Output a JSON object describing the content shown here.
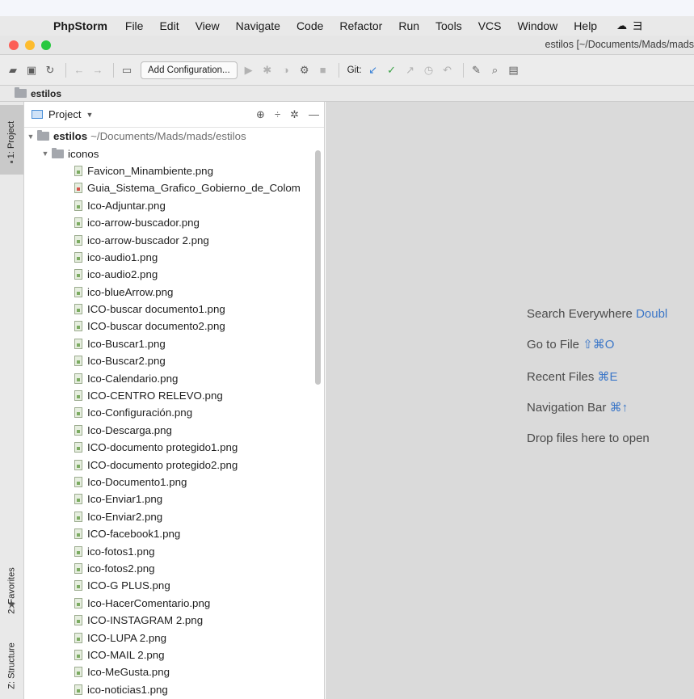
{
  "menubar": {
    "app_name": "PhpStorm",
    "items": [
      "File",
      "Edit",
      "View",
      "Navigate",
      "Code",
      "Refactor",
      "Run",
      "Tools",
      "VCS",
      "Window",
      "Help"
    ],
    "tail_glyph": "ヨ"
  },
  "window": {
    "title": "estilos [~/Documents/Mads/mads"
  },
  "toolbar": {
    "config_label": "Add Configuration...",
    "git_label": "Git:"
  },
  "navbar": {
    "crumb": "estilos"
  },
  "sidestrip": {
    "project_tab": "1: Project",
    "favorites_tab": "2: Favorites",
    "structure_tab": "Z: Structure"
  },
  "project": {
    "header_label": "Project",
    "root_name": "estilos",
    "root_path": "~/Documents/Mads/mads/estilos",
    "folder_name": "iconos",
    "files": [
      "Favicon_Minambiente.png",
      "Guia_Sistema_Grafico_Gobierno_de_Colom",
      "Ico-Adjuntar.png",
      "ico-arrow-buscador.png",
      "ico-arrow-buscador 2.png",
      "ico-audio1.png",
      "ico-audio2.png",
      "ico-blueArrow.png",
      "ICO-buscar documento1.png",
      "ICO-buscar documento2.png",
      "Ico-Buscar1.png",
      "Ico-Buscar2.png",
      "Ico-Calendario.png",
      "ICO-CENTRO RELEVO.png",
      "Ico-Configuración.png",
      "Ico-Descarga.png",
      "ICO-documento protegido1.png",
      "ICO-documento protegido2.png",
      "Ico-Documento1.png",
      "Ico-Enviar1.png",
      "Ico-Enviar2.png",
      "ICO-facebook1.png",
      "ico-fotos1.png",
      "ico-fotos2.png",
      "ICO-G PLUS.png",
      "Ico-HacerComentario.png",
      "ICO-INSTAGRAM 2.png",
      "ICO-LUPA 2.png",
      "ICO-MAIL 2.png",
      "Ico-MeGusta.png",
      "ico-noticias1.png"
    ]
  },
  "editor": {
    "hints": [
      {
        "text": "Search Everywhere ",
        "key": "Doubl"
      },
      {
        "text": "Go to File ",
        "key": "⇧⌘O"
      },
      {
        "text": "Recent Files ",
        "key": "⌘E"
      },
      {
        "text": "Navigation Bar ",
        "key": "⌘↑"
      },
      {
        "text": "Drop files here to open",
        "key": ""
      }
    ]
  }
}
